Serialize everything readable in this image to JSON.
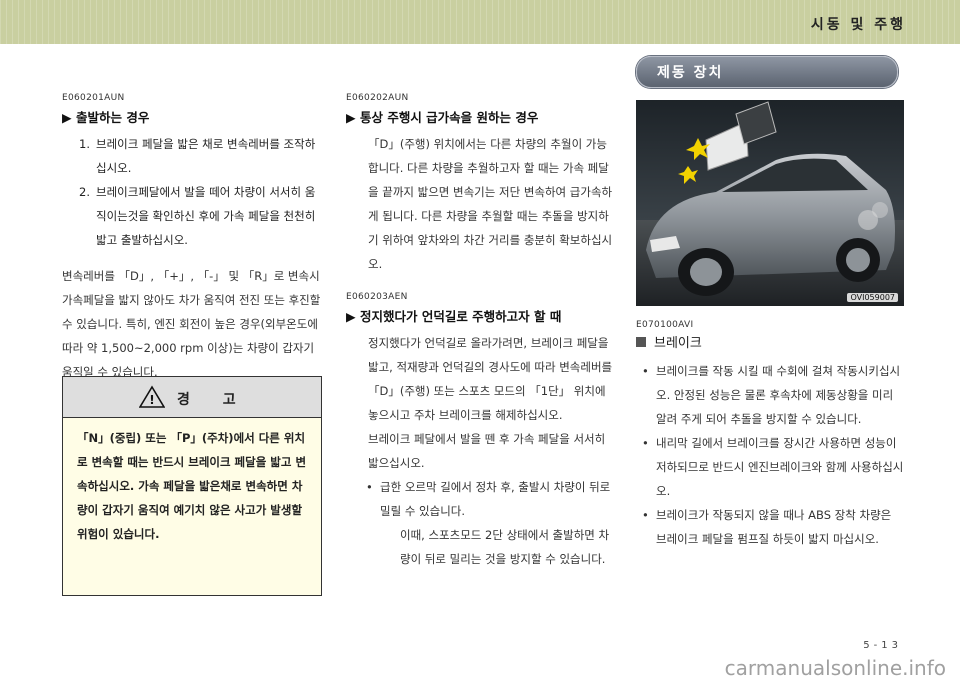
{
  "header": {
    "section_title": "시동 및 주행"
  },
  "col1": {
    "code": "E060201AUN",
    "heading": "▶ 출발하는 경우",
    "steps": [
      {
        "n": "1.",
        "text": "브레이크 페달을 밟은 채로 변속레버를 조작하십시오."
      },
      {
        "n": "2.",
        "text": "브레이크페달에서 발을 떼어 차량이 서서히 움직이는것을 확인하신 후에 가속 페달을 천천히 밟고 출발하십시오."
      }
    ],
    "paragraph": "변속레버를 「D」, 「+」, 「-」 및 「R」로 변속시 가속페달을 밟지 않아도 차가 움직여 전진 또는 후진할 수 있습니다. 특히, 엔진 회전이 높은 경우(외부온도에 따라 약 1,500~2,000 rpm 이상)는 차량이 갑자기 움직일 수 있습니다."
  },
  "warning": {
    "icon_glyph": "!",
    "title": "경 고",
    "text": "「N」(중립) 또는 「P」(주차)에서 다른 위치로 변속할 때는 반드시 브레이크 페달을 밟고 변속하십시오. 가속 페달을 밟은채로 변속하면 차량이 갑자기 움직여 예기치 않은 사고가 발생할 위험이 있습니다."
  },
  "col2": {
    "section1": {
      "code": "E060202AUN",
      "heading": "▶ 통상 주행시 급가속을 원하는 경우",
      "text": "「D」(주행) 위치에서는 다른 차량의 추월이 가능합니다. 다른 차량을 추월하고자 할 때는 가속 페달을 끝까지 밟으면 변속기는 저단 변속하여 급가속하게 됩니다. 다른 차량을 추월할 때는 추돌을 방지하기 위하여 앞차와의 차간 거리를 충분히 확보하십시오."
    },
    "section2": {
      "code": "E060203AEN",
      "heading": "▶ 정지했다가 언덕길로 주행하고자 할 때",
      "text1": "정지했다가 언덕길로 올라가려면, 브레이크 페달을 밟고, 적재량과 언덕길의 경사도에 따라 변속레버를 「D」(주행) 또는 스포츠 모드의 「1단」 위치에 놓으시고 주차 브레이크를 해제하십시오.",
      "text2": "브레이크 페달에서 발을 뗀 후 가속 페달을 서서히 밟으십시오.",
      "bullet": "급한 오르막 길에서 정차 후, 출발시 차량이 뒤로 밀릴 수 있습니다.",
      "note": "이때, 스포츠모드 2단 상태에서 출발하면 차량이 뒤로 밀리는 것을 방지할 수 있습니다."
    }
  },
  "col3": {
    "pill_title": "제동 장치",
    "photo_id": "OVI059007",
    "code": "E070100AVI",
    "subhead": "브레이크",
    "bullets": [
      "브레이크를 작동 시킬 때 수회에 걸쳐 작동시키십시오. 안정된 성능은 물론 후속차에 제동상황을 미리 알려 주게 되어 추돌을 방지할 수 있습니다.",
      "내리막 길에서 브레이크를 장시간 사용하면 성능이 저하되므로 반드시 엔진브레이크와 함께 사용하십시오.",
      "브레이크가 작동되지 않을 때나 ABS 장착 차량은 브레이크 페달을 펌프질 하듯이 밟지 마십시오."
    ]
  },
  "footer": {
    "page_number": "5-13",
    "watermark": "carmanualsonline.info"
  }
}
